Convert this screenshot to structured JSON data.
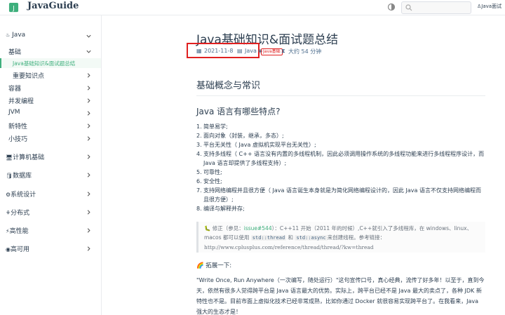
{
  "header": {
    "site_title": "JavaGuide",
    "search_placeholder": "",
    "top_link": "Java面试"
  },
  "sidebar": {
    "items": [
      {
        "label": "Java",
        "expanded": true
      },
      {
        "label": "基础",
        "expanded": true
      },
      {
        "label": "Java基础知识&面试题总结",
        "active": true
      },
      {
        "label": "重要知识点"
      },
      {
        "label": "容器"
      },
      {
        "label": "并发编程"
      },
      {
        "label": "JVM"
      },
      {
        "label": "新特性"
      },
      {
        "label": "小技巧"
      },
      {
        "label": "计算机基础"
      },
      {
        "label": "数据库"
      },
      {
        "label": "系统设计"
      },
      {
        "label": "分布式"
      },
      {
        "label": "高性能"
      },
      {
        "label": "高可用"
      }
    ]
  },
  "article": {
    "title": "Java基础知识&面试题总结",
    "meta": {
      "date": "2021-11-8",
      "category": "Java",
      "tag": "Java基础",
      "reading_time": "大约 54 分钟"
    },
    "h2": "基础概念与常识",
    "h3": "Java 语言有哪些特点?",
    "features": [
      {
        "num": "1.",
        "text": "简单易学;"
      },
      {
        "num": "2.",
        "text": "面向对象（封装，继承，多态）;"
      },
      {
        "num": "3.",
        "text": "平台无关性（ Java 虚拟机实现平台无关性）;"
      },
      {
        "num": "4.",
        "text": "支持多线程（ C++ 语言没有内置的多线程机制，因此必须调用操作系统的多线程功能来进行多线程程序设计，而 Java 语言却提供了多线程支持）;"
      },
      {
        "num": "5.",
        "text": "可靠性;"
      },
      {
        "num": "6.",
        "text": "安全性;"
      },
      {
        "num": "7.",
        "text": "支持网络编程并且很方便（ Java 语言诞生本身就是为简化网络编程设计的，因此 Java 语言不仅支持网络编程而且很方便）;"
      },
      {
        "num": "8.",
        "text": "编译与解释并存;"
      }
    ],
    "note": {
      "icon": "🐛",
      "prefix": "修正（参见：",
      "issue": "issue#544",
      "mid1": "）：C++11 开始（2011 年的时候）,C++就引入了多线程库，在 windows、linux、macos 都可以使用",
      "code1": "std::thread",
      "and": "和",
      "code2": "std::async",
      "mid2": "来创建线程。参考链接：",
      "link": "http://www.cplusplus.com/reference/thread/thread/?kw=thread"
    },
    "extend": {
      "icon": "🌈",
      "label": "拓展一下:"
    },
    "paragraph": "\"Write Once, Run Anywhere（一次编写，随处运行）\"这句宣传口号，真心经典，流传了好多年！以至于，直到今天，依然有很多人觉得跨平台是 Java 语言最大的优势。实际上，跨平台已经不是 Java 最大的卖点了，各种 JDK 新特性也不是。目前市面上虚拟化技术已经非常成熟，比如你通过 Docker 就很容易实现跨平台了。在我看来，Java 强大的生态才是！"
  },
  "colors": {
    "accent": "#3eaf7c",
    "highlight_red": "#e02020",
    "text": "#2c3e50"
  }
}
